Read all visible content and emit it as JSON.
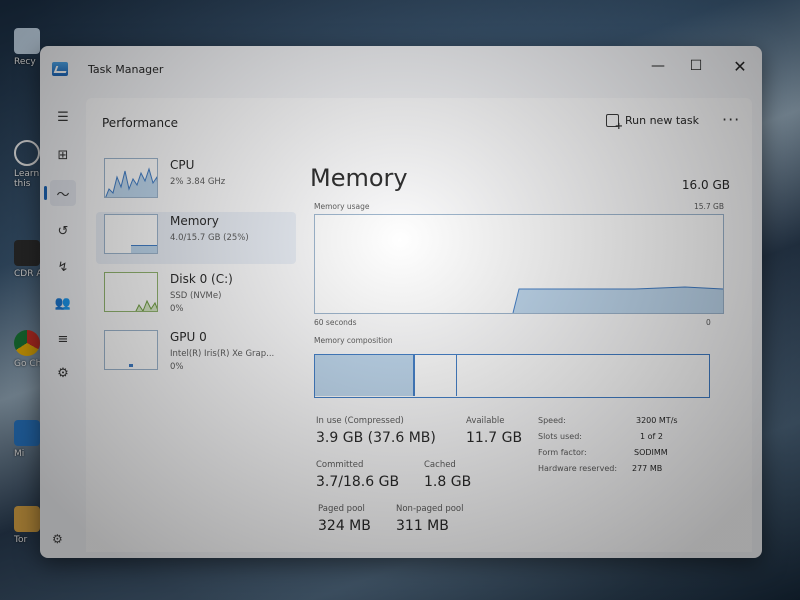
{
  "desktop": {
    "icons": [
      {
        "label": "Recy"
      },
      {
        "label": "Learn this"
      },
      {
        "label": "CDR An"
      },
      {
        "label": "Go Ch"
      },
      {
        "label": "Mi"
      },
      {
        "label": "Tor"
      }
    ]
  },
  "window": {
    "title": "Task Manager",
    "minimize": "—",
    "maximize": "☐",
    "close": "✕"
  },
  "sidebar": {
    "items": [
      {
        "icon": "hamburger-icon",
        "glyph": "☰"
      },
      {
        "icon": "processes-icon",
        "glyph": "⊞"
      },
      {
        "icon": "performance-icon",
        "glyph": "〜"
      },
      {
        "icon": "app-history-icon",
        "glyph": "↺"
      },
      {
        "icon": "startup-apps-icon",
        "glyph": "↯"
      },
      {
        "icon": "users-icon",
        "glyph": "👥"
      },
      {
        "icon": "details-icon",
        "glyph": "≡"
      },
      {
        "icon": "services-icon",
        "glyph": "⚙"
      }
    ],
    "settings_glyph": "⚙"
  },
  "header": {
    "title": "Performance",
    "run_new_task": "Run new task",
    "more": "···"
  },
  "perf_list": [
    {
      "name": "CPU",
      "line1": "2% 3.84 GHz",
      "line2": ""
    },
    {
      "name": "Memory",
      "line1": "4.0/15.7 GB (25%)",
      "line2": ""
    },
    {
      "name": "Disk 0 (C:)",
      "line1": "SSD (NVMe)",
      "line2": "0%"
    },
    {
      "name": "GPU 0",
      "line1": "Intel(R) Iris(R) Xe Grap...",
      "line2": "0%"
    }
  ],
  "memory": {
    "title": "Memory",
    "total": "16.0 GB",
    "usage_label": "Memory usage",
    "usage_max": "15.7 GB",
    "time_left": "60 seconds",
    "time_right": "0",
    "composition_label": "Memory composition",
    "stats": {
      "in_use_label": "In use (Compressed)",
      "in_use_value": "3.9 GB (37.6 MB)",
      "available_label": "Available",
      "available_value": "11.7 GB",
      "committed_label": "Committed",
      "committed_value": "3.7/18.6 GB",
      "cached_label": "Cached",
      "cached_value": "1.8 GB",
      "paged_label": "Paged pool",
      "paged_value": "324 MB",
      "nonpaged_label": "Non-paged pool",
      "nonpaged_value": "311 MB"
    },
    "specs": [
      {
        "label": "Speed:",
        "value": "3200 MT/s"
      },
      {
        "label": "Slots used:",
        "value": "1 of 2"
      },
      {
        "label": "Form factor:",
        "value": "SODIMM"
      },
      {
        "label": "Hardware reserved:",
        "value": "277 MB"
      }
    ]
  },
  "colors": {
    "accent": "#1a64b8",
    "graph_line": "#3b7ac6",
    "graph_fill": "#bdd7ee"
  }
}
